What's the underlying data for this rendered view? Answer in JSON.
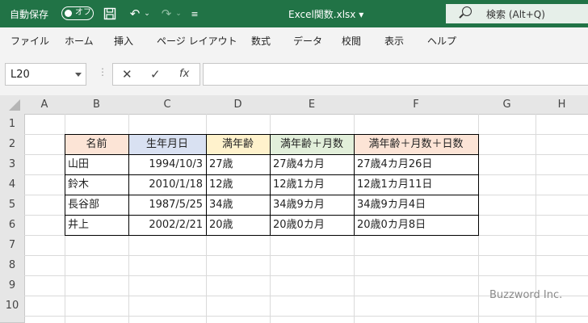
{
  "titlebar": {
    "autosave_label": "自動保存",
    "autosave_state": "オフ",
    "filename": "Excel関数.xlsx ▾",
    "search_label": "検索 (Alt+Q)",
    "accent": "#217346"
  },
  "ribbon": {
    "tabs": [
      "ファイル",
      "ホーム",
      "挿入",
      "ページ レイアウト",
      "数式",
      "データ",
      "校閲",
      "表示",
      "ヘルプ"
    ]
  },
  "formula_bar": {
    "name_box": "L20",
    "formula": ""
  },
  "sheet": {
    "columns": [
      "A",
      "B",
      "C",
      "D",
      "E",
      "F",
      "G",
      "H"
    ],
    "rows": [
      "1",
      "2",
      "3",
      "4",
      "5",
      "6",
      "7",
      "8",
      "9",
      "10"
    ],
    "table": {
      "headers": [
        "名前",
        "生年月日",
        "満年齢",
        "満年齢＋月数",
        "満年齢＋月数＋日数"
      ],
      "header_colors": [
        "#fce4d6",
        "#d9e1f2",
        "#fff2cc",
        "#e2efda",
        "#fce4d6"
      ],
      "rows": [
        [
          "山田",
          "1994/10/3",
          "27歳",
          "27歳4カ月",
          "27歳4カ月26日"
        ],
        [
          "鈴木",
          "2010/1/18",
          "12歳",
          "12歳1カ月",
          "12歳1カ月11日"
        ],
        [
          "長谷部",
          "1987/5/25",
          "34歳",
          "34歳9カ月",
          "34歳9カ月4日"
        ],
        [
          "井上",
          "2002/2/21",
          "20歳",
          "20歳0カ月",
          "20歳0カ月8日"
        ]
      ]
    }
  },
  "watermark": "Buzzword Inc."
}
